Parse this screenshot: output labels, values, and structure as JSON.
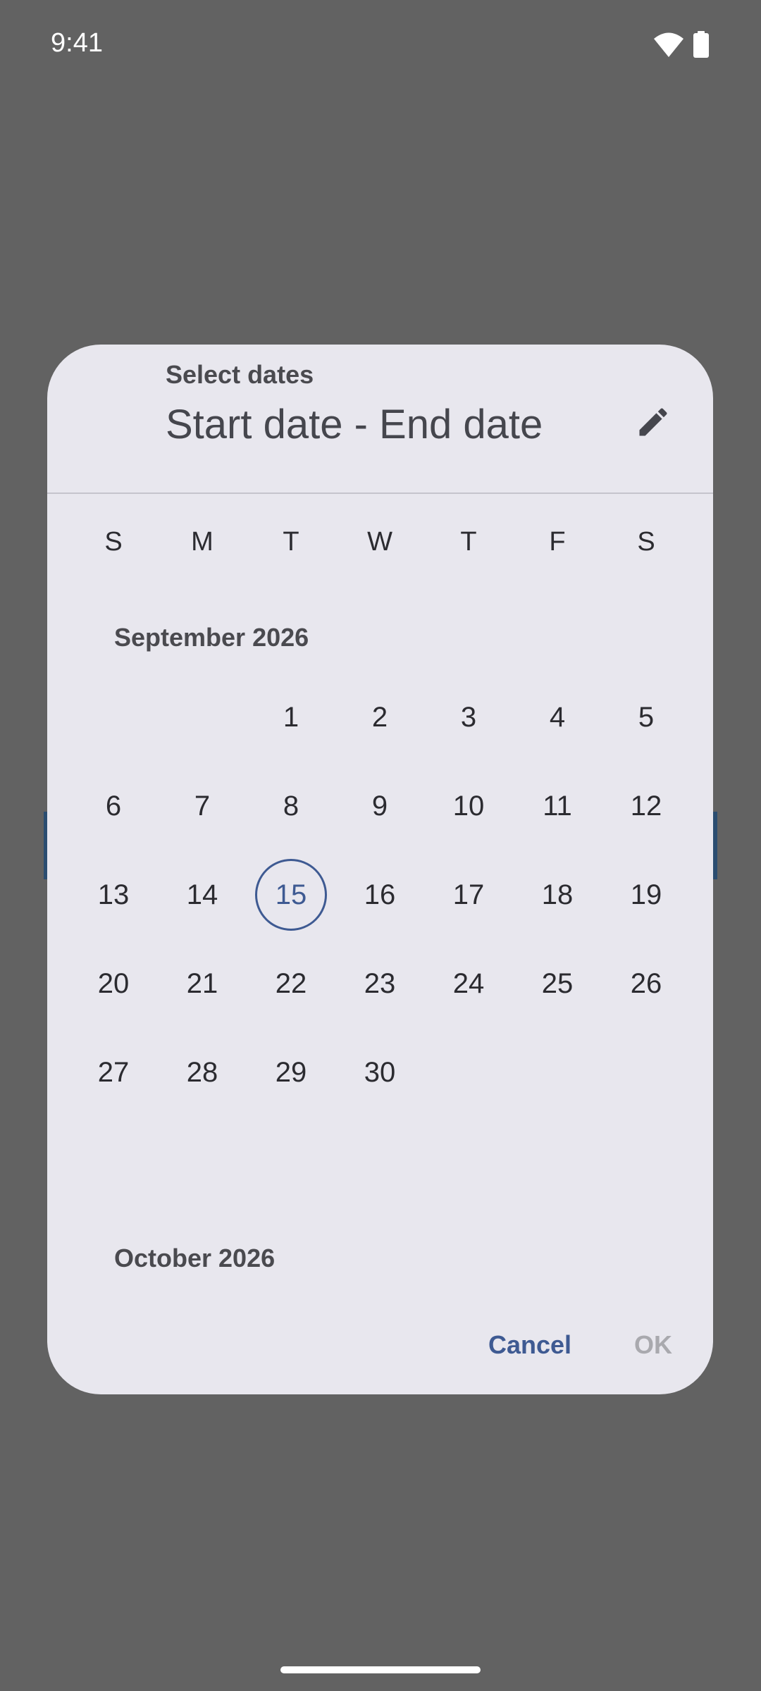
{
  "status_bar": {
    "time": "9:41",
    "icons": [
      "wifi-icon",
      "battery-icon"
    ]
  },
  "dialog": {
    "headline": "Select dates",
    "range_text": "Start date - End date",
    "edit_icon": "pencil-icon",
    "weekdays": [
      "S",
      "M",
      "T",
      "W",
      "T",
      "F",
      "S"
    ],
    "months": [
      {
        "label": "September 2026",
        "first_weekday_index": 2,
        "days": [
          "1",
          "2",
          "3",
          "4",
          "5",
          "6",
          "7",
          "8",
          "9",
          "10",
          "11",
          "12",
          "13",
          "14",
          "15",
          "16",
          "17",
          "18",
          "19",
          "20",
          "21",
          "22",
          "23",
          "24",
          "25",
          "26",
          "27",
          "28",
          "29",
          "30"
        ],
        "today": "15"
      },
      {
        "label": "October 2026"
      }
    ],
    "actions": {
      "cancel": "Cancel",
      "ok": "OK"
    }
  },
  "colors": {
    "scrim": "#626262",
    "dialog_surface": "#e8e7ee",
    "primary": "#3e5a92",
    "disabled": "#a9a9ae"
  }
}
